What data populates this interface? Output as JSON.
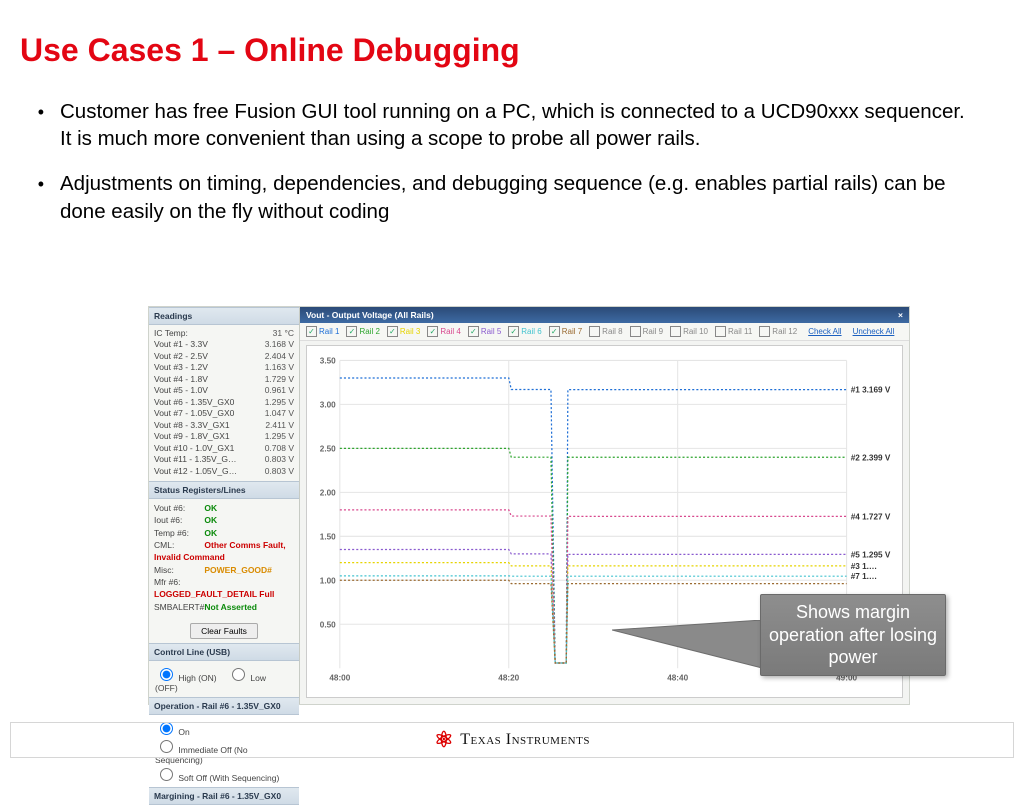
{
  "title": "Use Cases 1 – Online Debugging",
  "bullets": [
    "Customer has free Fusion GUI tool running on a PC, which is connected to a UCD90xxx sequencer. It is much more convenient than using a scope to probe all power rails.",
    "Adjustments on timing, dependencies, and debugging sequence (e.g. enables partial rails) can be done easily on the fly without coding"
  ],
  "readings_title": "Readings",
  "ic_temp_label": "IC Temp:",
  "ic_temp_value": "31 °C",
  "readings": [
    {
      "name": "Vout #1 - 3.3V",
      "val": "3.168 V"
    },
    {
      "name": "Vout #2 - 2.5V",
      "val": "2.404 V"
    },
    {
      "name": "Vout #3 - 1.2V",
      "val": "1.163 V"
    },
    {
      "name": "Vout #4 - 1.8V",
      "val": "1.729 V"
    },
    {
      "name": "Vout #5 - 1.0V",
      "val": "0.961 V"
    },
    {
      "name": "Vout #6 - 1.35V_GX0",
      "val": "1.295 V"
    },
    {
      "name": "Vout #7 - 1.05V_GX0",
      "val": "1.047 V"
    },
    {
      "name": "Vout #8 - 3.3V_GX1",
      "val": "2.411 V"
    },
    {
      "name": "Vout #9 - 1.8V_GX1",
      "val": "1.295 V"
    },
    {
      "name": "Vout #10 - 1.0V_GX1",
      "val": "0.708 V"
    },
    {
      "name": "Vout #11 - 1.35V_G…",
      "val": "0.803 V"
    },
    {
      "name": "Vout #12 - 1.05V_G…",
      "val": "0.803 V"
    }
  ],
  "status_title": "Status Registers/Lines",
  "status": [
    {
      "lbl": "Vout #6:",
      "val": "OK",
      "cls": "ok"
    },
    {
      "lbl": "Iout #6:",
      "val": "OK",
      "cls": "ok"
    },
    {
      "lbl": "Temp #6:",
      "val": "OK",
      "cls": "ok"
    },
    {
      "lbl": "CML:",
      "val": "Other Comms Fault, Invalid Command",
      "cls": "flt"
    },
    {
      "lbl": "Misc:",
      "val": "POWER_GOOD#",
      "cls": "wrn"
    },
    {
      "lbl": "Mfr #6:",
      "val": "LOGGED_FAULT_DETAIL Full",
      "cls": "flt"
    },
    {
      "lbl": "SMBALERT#",
      "val": "Not Asserted",
      "cls": "ok"
    }
  ],
  "clear_faults": "Clear Faults",
  "control_title": "Control Line (USB)",
  "control_high": "High (ON)",
  "control_low": "Low (OFF)",
  "operation_title": "Operation - Rail #6 - 1.35V_GX0",
  "op_on": "On",
  "op_imm": "Immediate Off (No Sequencing)",
  "op_soft": "Soft Off (With Sequencing)",
  "margin_title": "Margining - Rail #6 - 1.35V_GX0",
  "plot_title": "Vout - Output Voltage (All Rails)",
  "plot_close": "×",
  "rails": [
    {
      "label": "Rail 1",
      "color": "#1f6fd6",
      "checked": true
    },
    {
      "label": "Rail 2",
      "color": "#2ea52e",
      "checked": true
    },
    {
      "label": "Rail 3",
      "color": "#e6d400",
      "checked": true
    },
    {
      "label": "Rail 4",
      "color": "#d8488e",
      "checked": true
    },
    {
      "label": "Rail 5",
      "color": "#8a5bcf",
      "checked": true
    },
    {
      "label": "Rail 6",
      "color": "#43c3cf",
      "checked": true
    },
    {
      "label": "Rail 7",
      "color": "#9a6a30",
      "checked": true
    },
    {
      "label": "Rail 8",
      "color": "#888",
      "checked": false
    },
    {
      "label": "Rail 9",
      "color": "#888",
      "checked": false
    },
    {
      "label": "Rail 10",
      "color": "#888",
      "checked": false
    },
    {
      "label": "Rail 11",
      "color": "#888",
      "checked": false
    },
    {
      "label": "Rail 12",
      "color": "#888",
      "checked": false
    }
  ],
  "check_all": "Check All",
  "uncheck_all": "Uncheck All",
  "value_labels": [
    {
      "txt": "#1 3.169 V",
      "y": 3.169
    },
    {
      "txt": "#2 2.399 V",
      "y": 2.399
    },
    {
      "txt": "#4 1.727 V",
      "y": 1.727
    },
    {
      "txt": "#5 1.295 V",
      "y": 1.295
    },
    {
      "txt": "#3 1.…",
      "y": 1.163
    },
    {
      "txt": "#7 1.…",
      "y": 1.047
    }
  ],
  "callout": "Shows margin operation after losing power",
  "footer_brand": "Texas Instruments",
  "chart_data": {
    "type": "line",
    "title": "Vout - Output Voltage (All Rails)",
    "ylabel": "",
    "xlabel": "",
    "x_ticks": [
      "48:00",
      "48:20",
      "48:40",
      "49:00"
    ],
    "x_range_seconds": [
      2880,
      2940
    ],
    "ylim": [
      0,
      3.5
    ],
    "y_ticks": [
      0.5,
      1.0,
      1.5,
      2.0,
      2.5,
      3.0,
      3.5
    ],
    "dropout_x": [
      2905,
      2907
    ],
    "series": [
      {
        "name": "Rail 1",
        "color": "#1f6fd6",
        "pre": 3.3,
        "mid": 3.17,
        "post": 3.169
      },
      {
        "name": "Rail 2",
        "color": "#2ea52e",
        "pre": 2.5,
        "mid": 2.4,
        "post": 2.399
      },
      {
        "name": "Rail 4",
        "color": "#d8488e",
        "pre": 1.8,
        "mid": 1.73,
        "post": 1.727
      },
      {
        "name": "Rail 5",
        "color": "#8a5bcf",
        "pre": 1.35,
        "mid": 1.3,
        "post": 1.295
      },
      {
        "name": "Rail 3",
        "color": "#e6d400",
        "pre": 1.2,
        "mid": 1.163,
        "post": 1.163
      },
      {
        "name": "Rail 6",
        "color": "#43c3cf",
        "pre": 1.05,
        "mid": 1.047,
        "post": 1.047
      },
      {
        "name": "Rail 7",
        "color": "#9a6a30",
        "pre": 1.0,
        "mid": 0.961,
        "post": 0.961
      }
    ]
  }
}
